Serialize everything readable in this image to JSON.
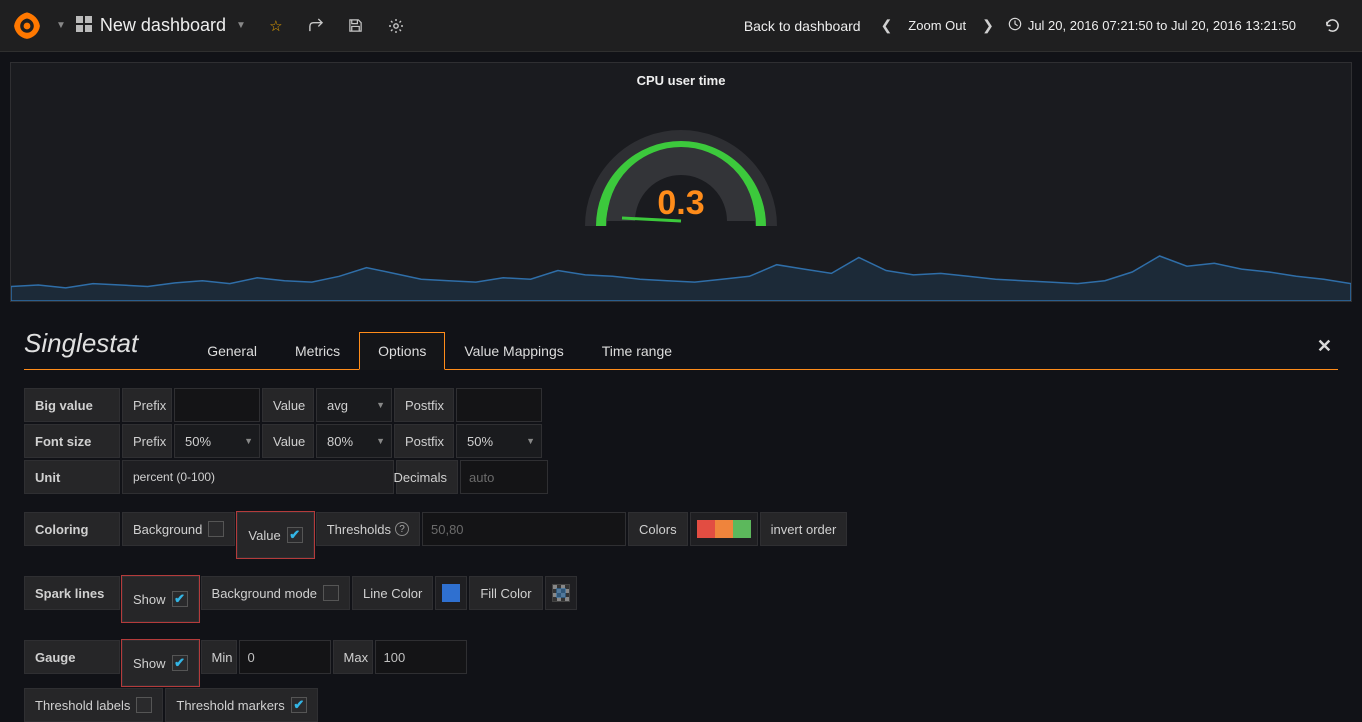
{
  "navbar": {
    "dashboard_title": "New dashboard",
    "back_link": "Back to dashboard",
    "zoom_out": "Zoom Out",
    "time_range": "Jul 20, 2016 07:21:50 to Jul 20, 2016 13:21:50"
  },
  "panel": {
    "title": "CPU user time",
    "value": "0.3"
  },
  "editor": {
    "type_title": "Singlestat",
    "tabs": {
      "general": "General",
      "metrics": "Metrics",
      "options": "Options",
      "value_mappings": "Value Mappings",
      "time_range": "Time range"
    }
  },
  "options": {
    "big_value_hdr": "Big value",
    "font_size_hdr": "Font size",
    "unit_hdr": "Unit",
    "prefix_lbl": "Prefix",
    "value_lbl": "Value",
    "postfix_lbl": "Postfix",
    "value_sel": "avg",
    "prefix_size": "50%",
    "value_size": "80%",
    "postfix_size": "50%",
    "unit_value": "percent (0-100)",
    "decimals_lbl": "Decimals",
    "decimals_ph": "auto",
    "coloring_hdr": "Coloring",
    "background_lbl": "Background",
    "value_chk_lbl": "Value",
    "thresholds_lbl": "Thresholds",
    "thresholds_ph": "50,80",
    "colors_lbl": "Colors",
    "invert_lbl": "invert order",
    "spark_hdr": "Spark lines",
    "show_lbl": "Show",
    "bg_mode_lbl": "Background mode",
    "line_color_lbl": "Line Color",
    "fill_color_lbl": "Fill Color",
    "gauge_hdr": "Gauge",
    "min_lbl": "Min",
    "min_val": "0",
    "max_lbl": "Max",
    "max_val": "100",
    "thresh_labels_lbl": "Threshold labels",
    "thresh_markers_lbl": "Threshold markers"
  },
  "colors": {
    "line_color": "#2f70d0",
    "sw1": "#e24d42",
    "sw2": "#ef843c",
    "sw3": "#5cb85c"
  },
  "chart_data": {
    "type": "line",
    "title": "CPU user time",
    "ylabel": "percent",
    "ylim": [
      0,
      100
    ],
    "gauge_value": 0.3,
    "x": [
      0,
      1,
      2,
      3,
      4,
      5,
      6,
      7,
      8,
      9,
      10,
      11,
      12,
      13,
      14,
      15,
      16,
      17,
      18,
      19,
      20,
      21,
      22,
      23,
      24,
      25,
      26,
      27,
      28,
      29,
      30,
      31,
      32,
      33,
      34,
      35,
      36,
      37,
      38,
      39,
      40,
      41,
      42,
      43,
      44,
      45,
      46,
      47,
      48,
      49
    ],
    "values": [
      0.2,
      0.22,
      0.18,
      0.24,
      0.22,
      0.2,
      0.25,
      0.28,
      0.24,
      0.32,
      0.28,
      0.26,
      0.34,
      0.46,
      0.38,
      0.3,
      0.28,
      0.26,
      0.32,
      0.3,
      0.42,
      0.36,
      0.34,
      0.3,
      0.28,
      0.26,
      0.3,
      0.34,
      0.5,
      0.44,
      0.38,
      0.6,
      0.42,
      0.36,
      0.38,
      0.34,
      0.3,
      0.28,
      0.26,
      0.24,
      0.28,
      0.4,
      0.62,
      0.48,
      0.52,
      0.44,
      0.4,
      0.34,
      0.3,
      0.24
    ]
  }
}
